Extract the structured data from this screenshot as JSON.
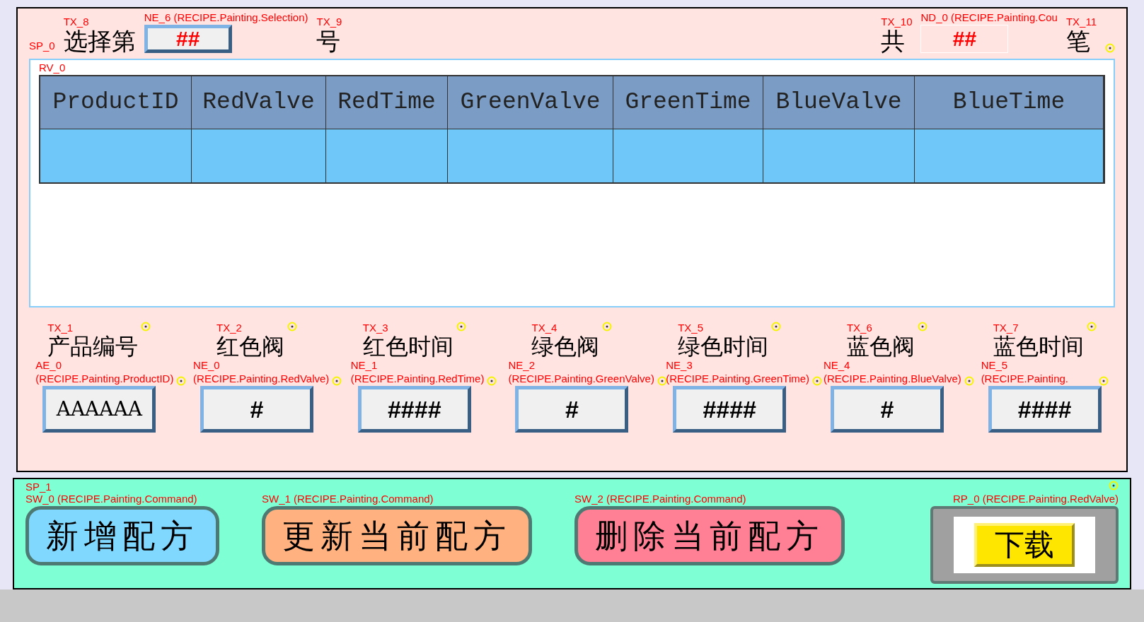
{
  "top_panel": {
    "tag": "SP_0",
    "selection": {
      "prefix_tag": "TX_8",
      "prefix": "选择第",
      "field_tag": "NE_6 (RECIPE.Painting.Selection)",
      "value": "##",
      "suffix_tag": "TX_9",
      "suffix": "号"
    },
    "count": {
      "prefix_tag": "TX_10",
      "prefix": "共",
      "field_tag": "ND_0 (RECIPE.Painting.Cou",
      "value": "##",
      "suffix_tag": "TX_11",
      "suffix": "笔"
    },
    "table": {
      "tag": "RV_0",
      "columns": [
        "ProductID",
        "RedValve",
        "RedTime",
        "GreenValve",
        "GreenTime",
        "BlueValve",
        "BlueTime"
      ],
      "rows": [
        {
          "selected": true
        }
      ]
    },
    "fields": [
      {
        "label_tag": "TX_1",
        "label": "产品编号",
        "field_tag": "AE_0 (RECIPE.Painting.ProductID)",
        "value": "AAAAAA",
        "kind": "text"
      },
      {
        "label_tag": "TX_2",
        "label": "红色阀",
        "field_tag": "NE_0 (RECIPE.Painting.RedValve)",
        "value": "#",
        "kind": "number"
      },
      {
        "label_tag": "TX_3",
        "label": "红色时间",
        "field_tag": "NE_1 (RECIPE.Painting.RedTime)",
        "value": "####",
        "kind": "number"
      },
      {
        "label_tag": "TX_4",
        "label": "绿色阀",
        "field_tag": "NE_2 (RECIPE.Painting.GreenValve)",
        "value": "#",
        "kind": "number"
      },
      {
        "label_tag": "TX_5",
        "label": "绿色时间",
        "field_tag": "NE_3 (RECIPE.Painting.GreenTime)",
        "value": "####",
        "kind": "number"
      },
      {
        "label_tag": "TX_6",
        "label": "蓝色阀",
        "field_tag": "NE_4 (RECIPE.Painting.BlueValve)",
        "value": "#",
        "kind": "number"
      },
      {
        "label_tag": "TX_7",
        "label": "蓝色时间",
        "field_tag": "NE_5 (RECIPE.Painting.",
        "value": "####",
        "kind": "number"
      }
    ]
  },
  "bottom_panel": {
    "tag": "SP_1",
    "buttons": [
      {
        "tag": "SW_0 (RECIPE.Painting.Command)",
        "label": "新增配方",
        "color": "#80d8ff"
      },
      {
        "tag": "SW_1 (RECIPE.Painting.Command)",
        "label": "更新当前配方",
        "color": "#ffb27f"
      },
      {
        "tag": "SW_2 (RECIPE.Painting.Command)",
        "label": "删除当前配方",
        "color": "#ff7f94"
      }
    ],
    "download": {
      "tag": "RP_0 (RECIPE.Painting.RedValve)",
      "label": "下载"
    }
  }
}
